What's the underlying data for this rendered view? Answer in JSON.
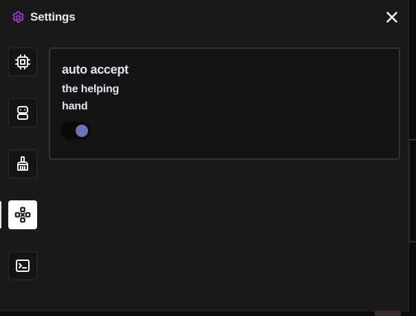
{
  "header": {
    "title": "Settings",
    "icon": "gear-icon",
    "accent_color": "#a23bd1"
  },
  "close_icon": "close-icon",
  "sidebar": {
    "items": [
      {
        "icon": "cpu-chip-icon",
        "active": false
      },
      {
        "icon": "robot-icon",
        "active": false
      },
      {
        "icon": "broom-icon",
        "active": false
      },
      {
        "icon": "gamepad-icon",
        "active": true
      },
      {
        "icon": "terminal-icon",
        "active": false
      }
    ]
  },
  "setting": {
    "title": "auto accept",
    "description": "the helping hand",
    "enabled": true,
    "toggle_knob_color": "#6a73b9"
  }
}
